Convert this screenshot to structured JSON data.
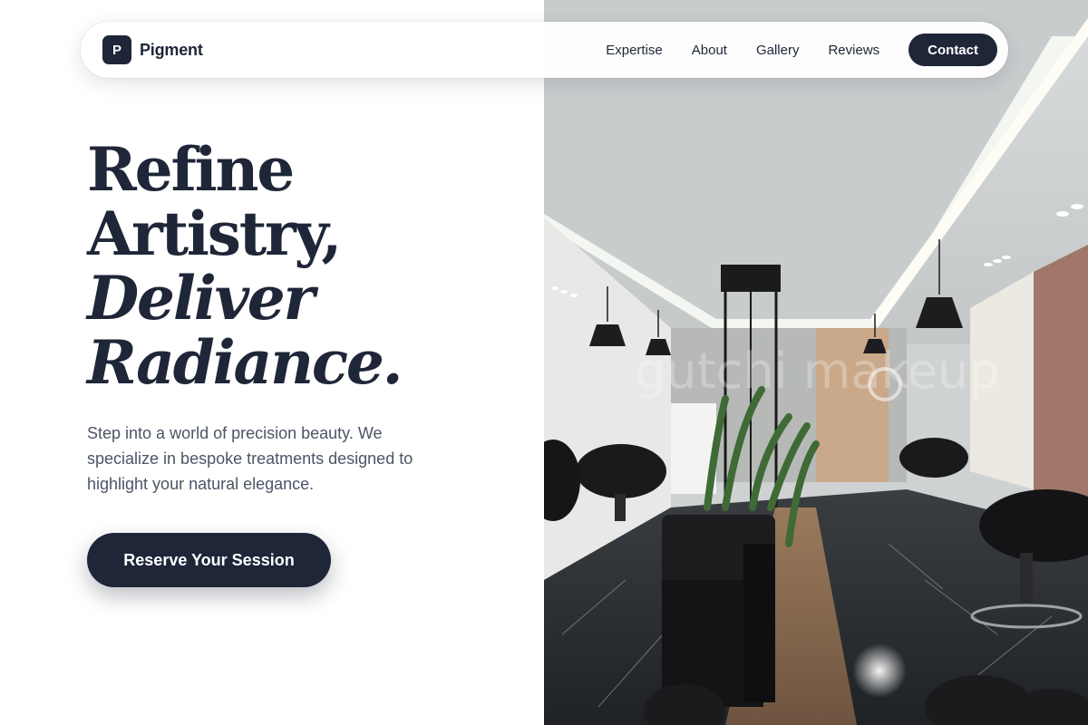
{
  "brand": {
    "mark": "P",
    "name": "Pigment"
  },
  "nav": {
    "links": [
      "Expertise",
      "About",
      "Gallery",
      "Reviews"
    ],
    "contact_label": "Contact"
  },
  "hero": {
    "headline": [
      "Refine",
      "Artistry,",
      "Deliver",
      "Radiance."
    ],
    "subtext": "Step into a world of precision beauty. We specialize in bespoke treatments designed to highlight your natural elegance.",
    "cta_label": "Reserve Your Session"
  },
  "photo": {
    "subject": "salon-interior",
    "watermark": "gutchi makeup"
  },
  "colors": {
    "primary": "#1e2638",
    "body_text": "#4b5566",
    "background": "#ffffff"
  }
}
